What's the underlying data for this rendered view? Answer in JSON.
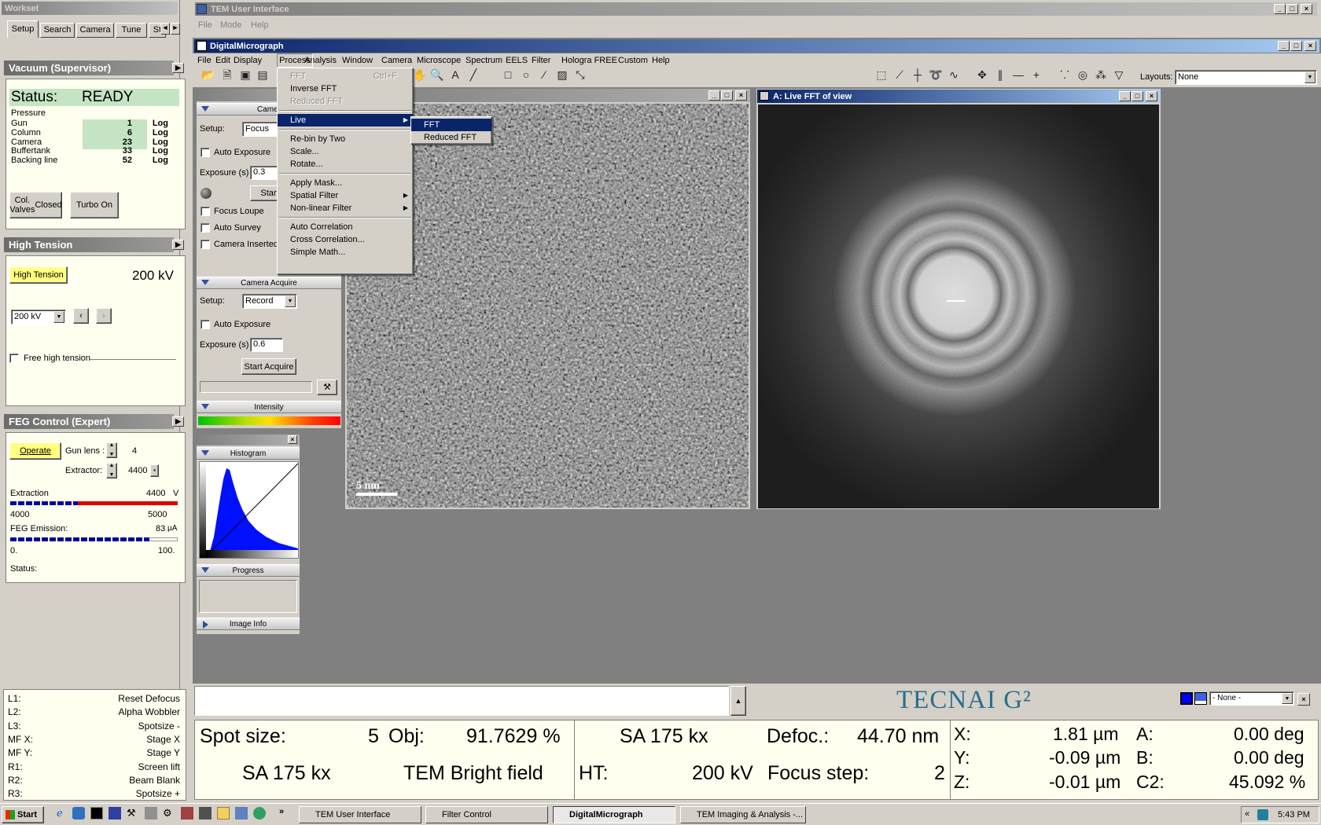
{
  "workset": {
    "title": "Workset",
    "tabs": [
      "Setup",
      "Search",
      "Camera",
      "Tune",
      "St"
    ]
  },
  "vacuum": {
    "title": "Vacuum (Supervisor)",
    "status_label": "Status:",
    "status_value": "READY",
    "pressure_label": "Pressure",
    "rows": [
      {
        "name": "Gun",
        "value": "1",
        "unit": "Log"
      },
      {
        "name": "Column",
        "value": "6",
        "unit": "Log"
      },
      {
        "name": "Camera",
        "value": "23",
        "unit": "Log"
      },
      {
        "name": "Buffertank",
        "value": "33",
        "unit": "Log"
      },
      {
        "name": "Backing line",
        "value": "52",
        "unit": "Log"
      }
    ],
    "col_valves_line1": "Col. Valves",
    "col_valves_line2": "Closed",
    "turbo": "Turbo On"
  },
  "ht": {
    "title": "High Tension",
    "button": "High Tension",
    "value": "200 kV",
    "select": "200 kV",
    "free": "Free high tension"
  },
  "feg": {
    "title": "FEG Control (Expert)",
    "operate": "Operate",
    "gun_lens_label": "Gun lens :",
    "gun_lens_value": "4",
    "extractor_label": "Extractor:",
    "extractor_value": "4400",
    "extraction_label": "Extraction",
    "extraction_value": "4400",
    "extraction_unit": "V",
    "scale_min": "4000",
    "scale_max": "5000",
    "emission_label": "FEG Emission:",
    "emission_value": "83",
    "emission_unit": "µA",
    "em_min": "0.",
    "em_max": "100.",
    "status_label": "Status:"
  },
  "lr": {
    "rows": [
      {
        "k": "L1:",
        "v": "Reset Defocus"
      },
      {
        "k": "L2:",
        "v": "Alpha Wobbler"
      },
      {
        "k": "L3:",
        "v": "Spotsize -"
      },
      {
        "k": "MF X:",
        "v": "Stage X"
      },
      {
        "k": "MF Y:",
        "v": "Stage Y"
      },
      {
        "k": "R1:",
        "v": "Screen lift"
      },
      {
        "k": "R2:",
        "v": "Beam Blank"
      },
      {
        "k": "R3:",
        "v": "Spotsize +"
      }
    ]
  },
  "tem": {
    "title": "TEM User Interface",
    "menu": [
      "File",
      "Mode",
      "Help"
    ]
  },
  "dm": {
    "title": "DigitalMicrograph",
    "menu": [
      "File",
      "Edit",
      "Display",
      "Process",
      "Analysis",
      "Window",
      "Camera",
      "Microscope",
      "Spectrum",
      "EELS",
      "Filter",
      "Hologra FREE",
      "Custom",
      "Help"
    ],
    "layouts_label": "Layouts:",
    "layouts_value": "None"
  },
  "process_menu": {
    "items": [
      {
        "label": "FFT",
        "shortcut": "Ctrl+F",
        "disabled": true
      },
      {
        "label": "Inverse FFT"
      },
      {
        "label": "Reduced FFT",
        "disabled": true
      },
      {
        "sep": true
      },
      {
        "label": "Live",
        "sub": true,
        "selected": true
      },
      {
        "sep": true
      },
      {
        "label": "Re-bin by Two"
      },
      {
        "label": "Scale..."
      },
      {
        "label": "Rotate..."
      },
      {
        "sep": true
      },
      {
        "label": "Apply Mask..."
      },
      {
        "label": "Spatial Filter",
        "sub": true
      },
      {
        "label": "Non-linear Filter",
        "sub": true
      },
      {
        "sep": true
      },
      {
        "label": "Auto Correlation"
      },
      {
        "label": "Cross Correlation..."
      },
      {
        "label": "Simple Math..."
      }
    ]
  },
  "live_submenu": [
    "FFT",
    "Reduced FFT"
  ],
  "camview": {
    "header": "Camer",
    "setup_label": "Setup:",
    "setup_value": "Focus",
    "auto_exposure": "Auto Exposure",
    "exposure_label": "Exposure (s)",
    "exposure_value": "0.3",
    "start": "Start",
    "focus_loupe": "Focus Loupe",
    "auto_survey": "Auto Survey",
    "camera_inserted": "Camera Inserted"
  },
  "camacq": {
    "header": "Camera Acquire",
    "setup_label": "Setup:",
    "setup_value": "Record",
    "auto_exposure": "Auto Exposure",
    "exposure_label": "Exposure (s)",
    "exposure_value": "0.6",
    "start": "Start Acquire",
    "intensity": "Intensity"
  },
  "histwin": {
    "histogram": "Histogram",
    "progress": "Progress",
    "image_info": "Image Info"
  },
  "image_window": {
    "scalebar": "5 nm"
  },
  "fft_window": {
    "title": "A: Live FFT of view"
  },
  "status": {
    "brand": "TECNAI G²",
    "none_select": "- None -",
    "spot_label": "Spot size:",
    "spot_value": "5",
    "obj_label": "Obj:",
    "obj_value": "91.7629 %",
    "mag1": "SA 175 kx",
    "defoc_label": "Defoc.:",
    "defoc_value": "44.70 nm",
    "mag2": "SA 175 kx",
    "mode": "TEM Bright field",
    "ht_label": "HT:",
    "ht_value": "200 kV",
    "focus_step_label": "Focus step:",
    "focus_step_value": "2",
    "x_label": "X:",
    "x_value": "1.81 µm",
    "a_label": "A:",
    "a_value": "0.00 deg",
    "y_label": "Y:",
    "y_value": "-0.09 µm",
    "b_label": "B:",
    "b_value": "0.00 deg",
    "z_label": "Z:",
    "z_value": "-0.01 µm",
    "c2_label": "C2:",
    "c2_value": "45.092 %"
  },
  "taskbar": {
    "start": "Start",
    "buttons": [
      "TEM User Interface",
      "Filter Control",
      "DigitalMicrograph",
      "TEM Imaging & Analysis -..."
    ],
    "clock": "5:43 PM"
  }
}
